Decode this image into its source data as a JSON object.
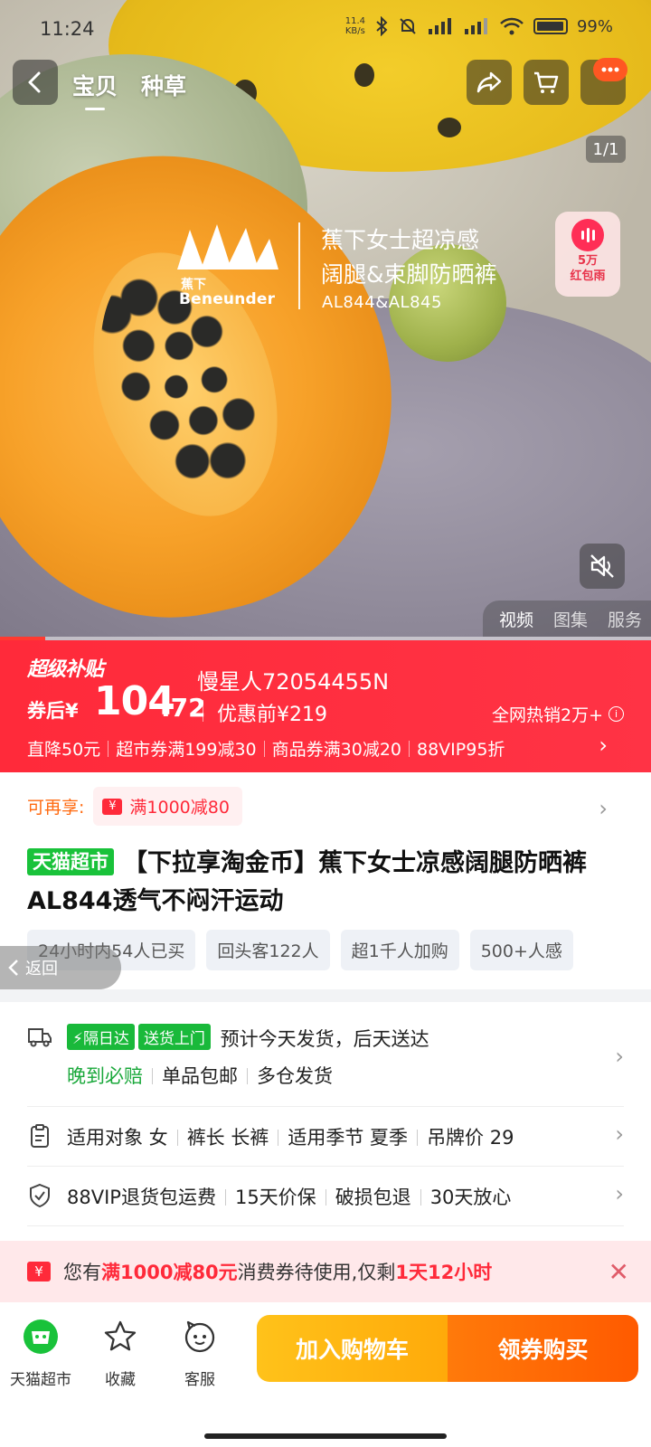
{
  "status_bar": {
    "time": "11:24",
    "net_speed_value": "11.4",
    "net_speed_unit": "KB/s",
    "battery": "99%"
  },
  "nav": {
    "tabs": [
      "宝贝",
      "种草"
    ],
    "active_tab": 0,
    "image_counter": "1/1",
    "icons": [
      "back-icon",
      "share-icon",
      "cart-icon",
      "more-icon"
    ]
  },
  "hero": {
    "brand_cn": "蕉下",
    "brand_en": "Beneunder",
    "headline_1": "蕉下女士超凉感",
    "headline_2": "阔腿&束脚防晒裤",
    "model": "AL844&AL845",
    "red_rain_line1": "5万",
    "red_rain_line2": "红包雨",
    "media_tabs": [
      "视频",
      "图集",
      "服务"
    ],
    "active_media_tab": 0,
    "video_progress": 0.07
  },
  "price": {
    "subsidy_label": "超级补贴",
    "user_name": "慢星人72054455N",
    "after_coupon_label": "券后¥",
    "price_int": "104",
    "price_dec": ".72",
    "before_label": "优惠前¥219",
    "hot_sales": "全网热销2万+",
    "promos": [
      "直降50元",
      "超市券满199减30",
      "商品券满30减20",
      "88VIP95折"
    ]
  },
  "detail": {
    "extra_label": "可再享:",
    "coupon_chip": "满1000减80",
    "store_tag": "天猫超市",
    "title": "【下拉享淘金币】蕉下女士凉感阔腿防晒裤AL844透气不闷汗运动",
    "chips": [
      "24小时内54人已买",
      "回头客122人",
      "超1千人加购",
      "500+人感"
    ],
    "back_pill": "返回"
  },
  "services": {
    "delivery_tag1": "隔日达",
    "delivery_tag2": "送货上门",
    "delivery_text": "预计今天发货，后天送达",
    "late_comp": "晚到必赔",
    "free_ship": "单品包邮",
    "multi_wh": "多仓发货",
    "spec_items": [
      "适用对象 女",
      "裤长 长裤",
      "适用季节 夏季",
      "吊牌价 29"
    ],
    "guarantee_items": [
      "88VIP退货包运费",
      "15天价保",
      "破损包退",
      "30天放心"
    ]
  },
  "notice": {
    "prefix": "您有",
    "amount": "满1000减80元",
    "middle": "消费券待使用,仅剩",
    "remain": "1天12小时"
  },
  "bottom_bar": {
    "items": [
      "天猫超市",
      "收藏",
      "客服"
    ],
    "add_cart": "加入购物车",
    "buy": "领券购买"
  },
  "colors": {
    "accent_red": "#ff2a3a",
    "tmall_green": "#19c23a",
    "cart_yellow": "#ffb414",
    "buy_orange": "#ff6a00"
  }
}
